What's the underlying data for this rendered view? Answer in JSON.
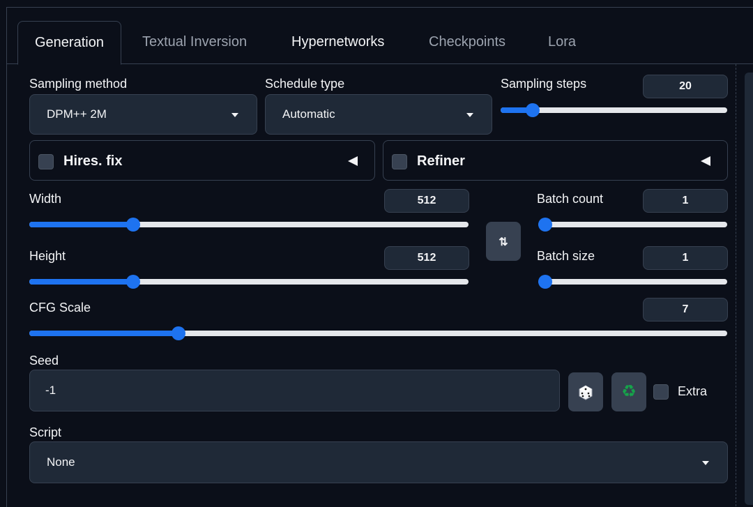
{
  "tabs": [
    {
      "label": "Generation"
    },
    {
      "label": "Textual Inversion"
    },
    {
      "label": "Hypernetworks"
    },
    {
      "label": "Checkpoints"
    },
    {
      "label": "Lora"
    }
  ],
  "sampling_method": {
    "label": "Sampling method",
    "value": "DPM++ 2M"
  },
  "schedule_type": {
    "label": "Schedule type",
    "value": "Automatic"
  },
  "sampling_steps": {
    "label": "Sampling steps",
    "value": "20",
    "level": 0.14
  },
  "hires_fix": {
    "label": "Hires. fix",
    "checked": false
  },
  "refiner": {
    "label": "Refiner",
    "checked": false
  },
  "width": {
    "label": "Width",
    "value": "512",
    "level": 0.236
  },
  "height": {
    "label": "Height",
    "value": "512",
    "level": 0.236
  },
  "batch_count": {
    "label": "Batch count",
    "value": "1",
    "level": 0.0
  },
  "batch_size": {
    "label": "Batch size",
    "value": "1",
    "level": 0.0
  },
  "cfg_scale": {
    "label": "CFG Scale",
    "value": "7",
    "level": 0.214
  },
  "seed": {
    "label": "Seed",
    "value": "-1",
    "extra_label": "Extra"
  },
  "script": {
    "label": "Script",
    "value": "None"
  },
  "icons": {
    "swap": "swap-dimensions-icon",
    "dice": "dice-icon",
    "recycle": "recycle-icon"
  },
  "colors": {
    "accent": "#1e73f0",
    "background": "#0b0f19",
    "panel": "#1f2937"
  }
}
